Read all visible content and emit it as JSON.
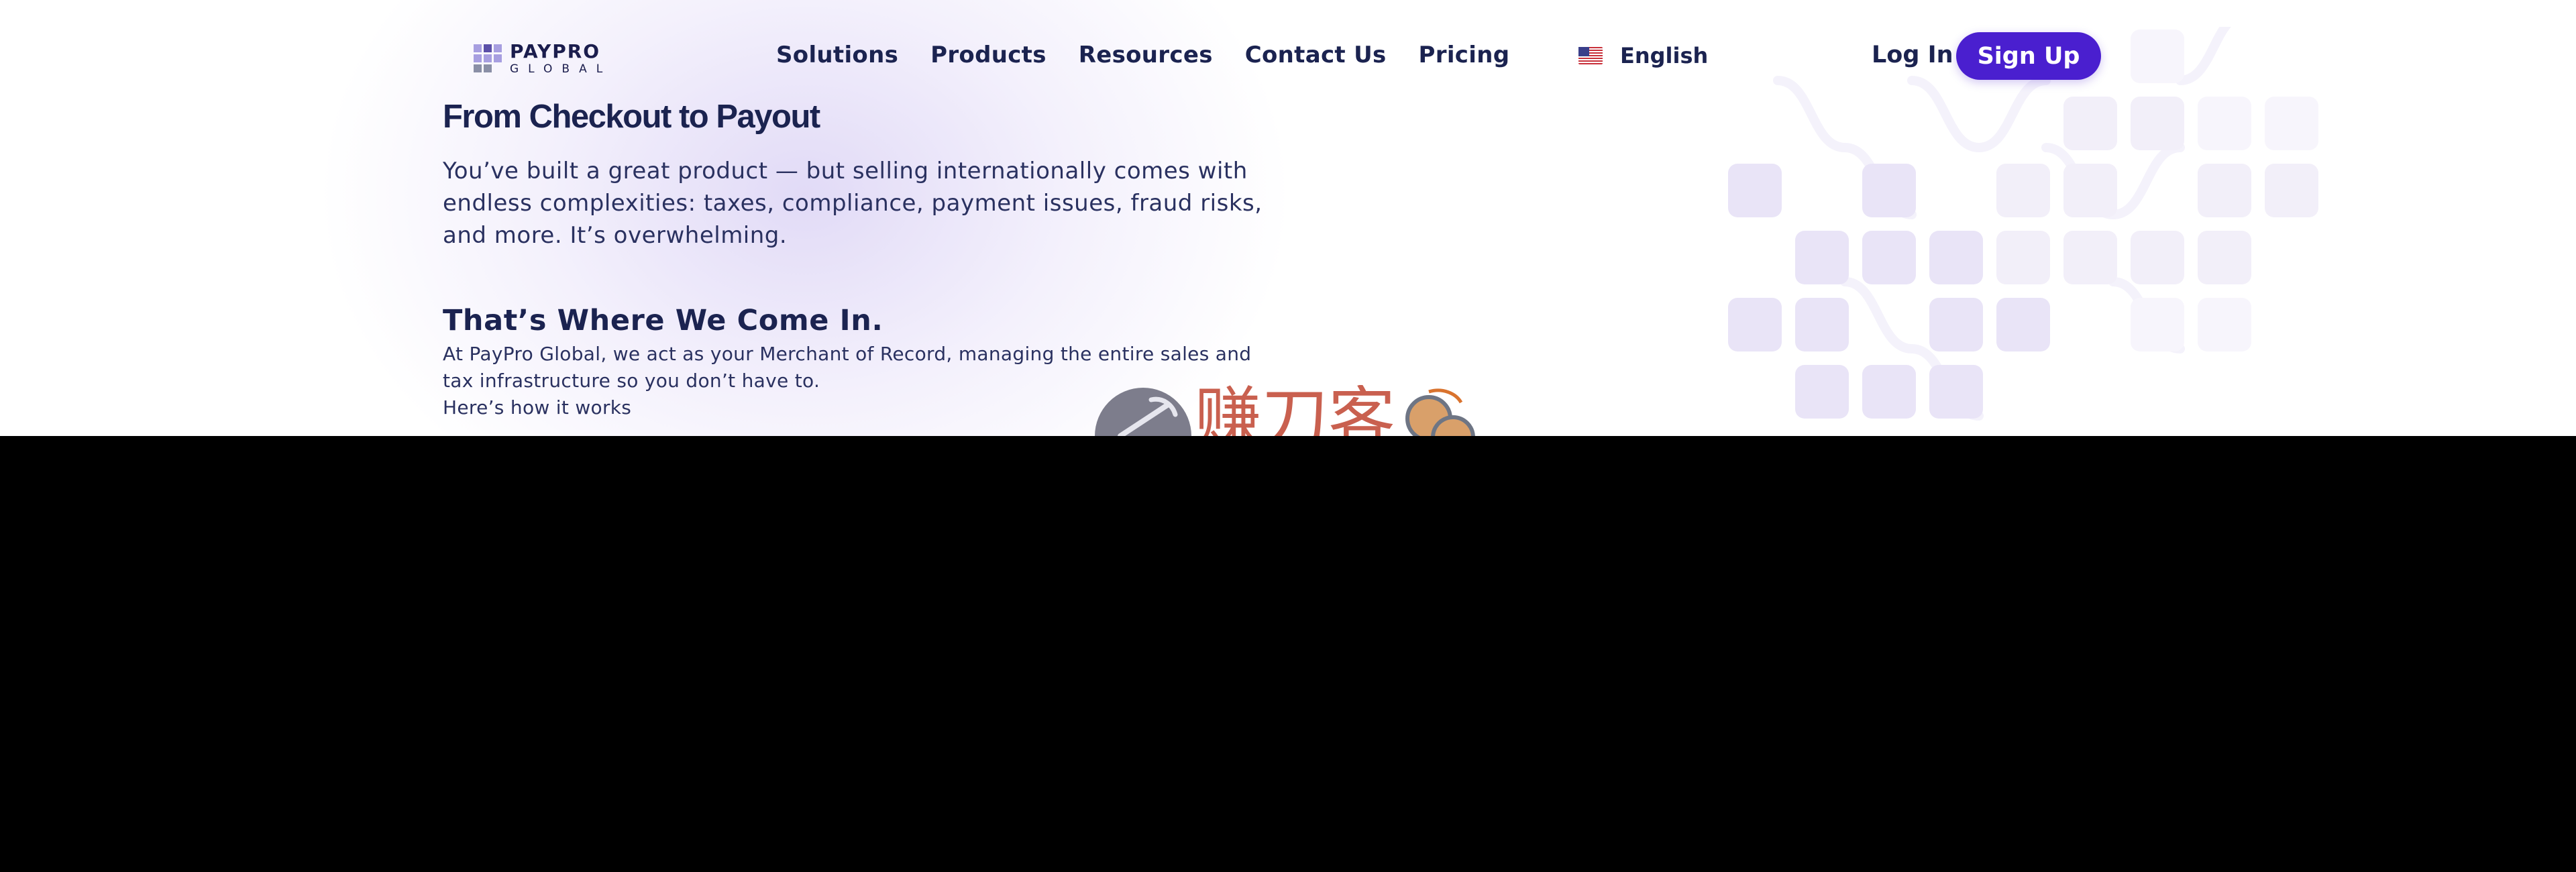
{
  "header": {
    "logo": {
      "line1": "PAYPRO",
      "line2": "GLOBAL"
    },
    "nav": [
      {
        "label": "Solutions"
      },
      {
        "label": "Products"
      },
      {
        "label": "Resources"
      },
      {
        "label": "Contact Us"
      },
      {
        "label": "Pricing"
      }
    ],
    "language": {
      "label": "English",
      "flag_icon": "us-flag-icon"
    },
    "login_label": "Log In",
    "signup_label": "Sign Up"
  },
  "hero": {
    "title": "From Checkout to Payout",
    "intro": "You’ve built a great product — but selling internationally comes with endless complexities: taxes, compliance, payment issues, fraud risks, and more. It’s overwhelming.",
    "subtitle": "That’s Where We Come In.",
    "body": "At PayPro Global, we act as your Merchant of Record, managing the entire sales and tax infrastructure so you don’t have to.",
    "how_it_works": "Here’s how it works"
  },
  "watermark": {
    "text": "赚刀客",
    "icon": "coin-badge-icon"
  },
  "colors": {
    "accent": "#4a1fcf",
    "text": "#1b2350",
    "pattern": "#e9e4f7",
    "background": "#ffffff"
  }
}
